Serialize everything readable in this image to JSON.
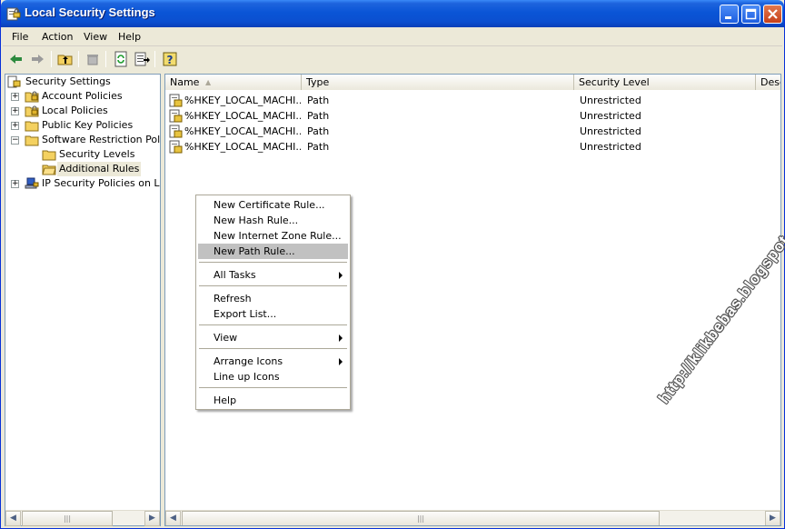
{
  "window": {
    "title": "Local Security Settings"
  },
  "menubar": [
    "File",
    "Action",
    "View",
    "Help"
  ],
  "toolbar": {
    "icons": [
      "back-arrow-icon",
      "forward-arrow-icon",
      "up-folder-icon",
      "delete-icon",
      "refresh-icon",
      "export-list-icon",
      "help-icon"
    ]
  },
  "tree": {
    "root": "Security Settings",
    "items": [
      {
        "label": "Account Policies",
        "expander": "+"
      },
      {
        "label": "Local Policies",
        "expander": "+"
      },
      {
        "label": "Public Key Policies",
        "expander": "+"
      },
      {
        "label": "Software Restriction Policies",
        "expander": "−"
      },
      {
        "label": "Security Levels",
        "expander": ""
      },
      {
        "label": "Additional Rules",
        "expander": "",
        "selected": true
      },
      {
        "label": "IP Security Policies on Local Computer",
        "expander": "+"
      }
    ]
  },
  "list": {
    "columns": [
      "Name",
      "Type",
      "Security Level",
      "Description"
    ],
    "rows": [
      {
        "name": "%HKEY_LOCAL_MACHI...",
        "type": "Path",
        "level": "Unrestricted"
      },
      {
        "name": "%HKEY_LOCAL_MACHI...",
        "type": "Path",
        "level": "Unrestricted"
      },
      {
        "name": "%HKEY_LOCAL_MACHI...",
        "type": "Path",
        "level": "Unrestricted"
      },
      {
        "name": "%HKEY_LOCAL_MACHI...",
        "type": "Path",
        "level": "Unrestricted"
      }
    ]
  },
  "context_menu": {
    "items": [
      {
        "label": "New Certificate Rule...",
        "highlighted": false,
        "submenu": false
      },
      {
        "label": "New Hash Rule...",
        "highlighted": false,
        "submenu": false
      },
      {
        "label": "New Internet Zone Rule...",
        "highlighted": false,
        "submenu": false
      },
      {
        "label": "New Path Rule...",
        "highlighted": true,
        "submenu": false
      },
      {
        "label": "All Tasks",
        "highlighted": false,
        "submenu": true
      },
      {
        "label": "Refresh",
        "highlighted": false,
        "submenu": false
      },
      {
        "label": "Export List...",
        "highlighted": false,
        "submenu": false
      },
      {
        "label": "View",
        "highlighted": false,
        "submenu": true
      },
      {
        "label": "Arrange Icons",
        "highlighted": false,
        "submenu": true
      },
      {
        "label": "Line up Icons",
        "highlighted": false,
        "submenu": false
      },
      {
        "label": "Help",
        "highlighted": false,
        "submenu": false
      }
    ]
  },
  "watermark": "http://klikbebas.blogspot.com/",
  "colors": {
    "titlebar": "#0a55d6",
    "highlight": "#c1c1c1",
    "pane_border": "#7f9db9"
  }
}
